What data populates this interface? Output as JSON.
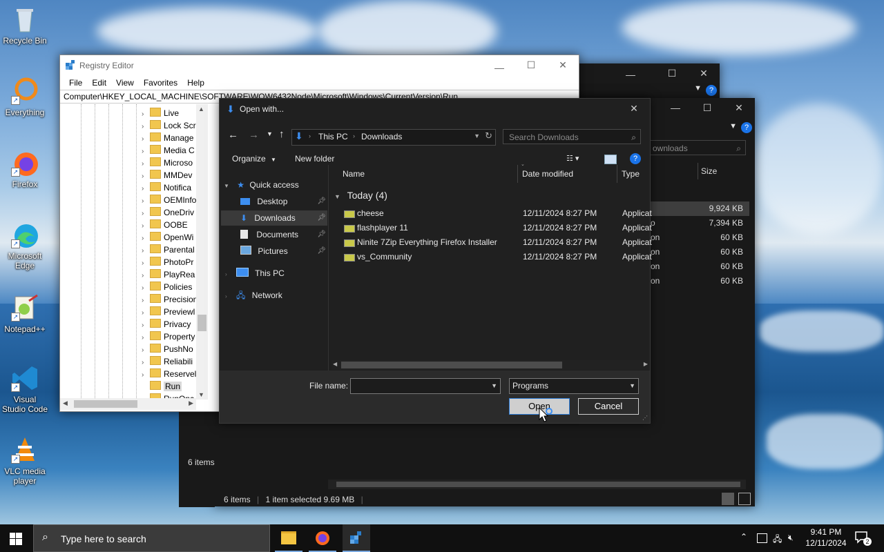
{
  "desktop": {
    "icons": [
      {
        "label": "Recycle Bin"
      },
      {
        "label": "Everything"
      },
      {
        "label": "Firefox"
      },
      {
        "label": "Microsoft Edge"
      },
      {
        "label": "Notepad++"
      },
      {
        "label": "Visual Studio Code"
      },
      {
        "label": "VLC media player"
      }
    ]
  },
  "registry": {
    "title": "Registry Editor",
    "menu": [
      "File",
      "Edit",
      "View",
      "Favorites",
      "Help"
    ],
    "address": "Computer\\HKEY_LOCAL_MACHINE\\SOFTWARE\\WOW6432Node\\Microsoft\\Windows\\CurrentVersion\\Run",
    "tree": [
      "Live",
      "Lock Scr",
      "Manage",
      "Media C",
      "Microso",
      "MMDev",
      "Notifica",
      "OEMInfo",
      "OneDriv",
      "OOBE",
      "OpenWi",
      "Parental",
      "PhotoPr",
      "PlayRea",
      "Policies",
      "Precision",
      "Previewl",
      "Privacy",
      "Property",
      "PushNo",
      "Reliabili",
      "Reservel",
      "Run",
      "RunOnc"
    ]
  },
  "explorer_back": {
    "search_placeholder": "ownloads",
    "size_header": "Size",
    "sizes": [
      "9,924 KB",
      "7,394 KB",
      "60 KB",
      "60 KB",
      "60 KB",
      "60 KB"
    ],
    "type_fragments": [
      "",
      "o",
      "on",
      "on",
      "on",
      "on"
    ],
    "left_status": "6 items",
    "status_items": "6 items",
    "status_selected": "1 item selected  9.69 MB"
  },
  "dialog": {
    "title": "Open with...",
    "breadcrumb": [
      "This PC",
      "Downloads"
    ],
    "search_placeholder": "Search Downloads",
    "organize": "Organize",
    "new_folder": "New folder",
    "nav": {
      "quick_access": "Quick access",
      "items": [
        "Desktop",
        "Downloads",
        "Documents",
        "Pictures"
      ],
      "this_pc": "This PC",
      "network": "Network"
    },
    "columns": {
      "name": "Name",
      "date": "Date modified",
      "type": "Type"
    },
    "group": "Today (4)",
    "files": [
      {
        "name": "cheese",
        "date": "12/11/2024 8:27 PM",
        "type": "Applicat"
      },
      {
        "name": "flashplayer 11",
        "date": "12/11/2024 8:27 PM",
        "type": "Applicat"
      },
      {
        "name": "Ninite 7Zip Everything Firefox Installer",
        "date": "12/11/2024 8:27 PM",
        "type": "Applicat"
      },
      {
        "name": "vs_Community",
        "date": "12/11/2024 8:27 PM",
        "type": "Applicat"
      }
    ],
    "file_name_label": "File name:",
    "file_name_value": "",
    "filter_value": "Programs",
    "open_label": "Open",
    "cancel_label": "Cancel"
  },
  "taskbar": {
    "search_placeholder": "Type here to search",
    "time": "9:41 PM",
    "date": "12/11/2024",
    "notification_count": "2"
  }
}
